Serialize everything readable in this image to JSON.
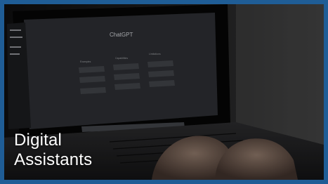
{
  "card": {
    "title_line1": "Digital",
    "title_line2": "Assistants",
    "frame_color": "#1f5d96",
    "text_color": "#ffffff"
  },
  "photo": {
    "screen_title": "ChatGPT",
    "column_headings": [
      "Examples",
      "Capabilities",
      "Limitations"
    ]
  }
}
